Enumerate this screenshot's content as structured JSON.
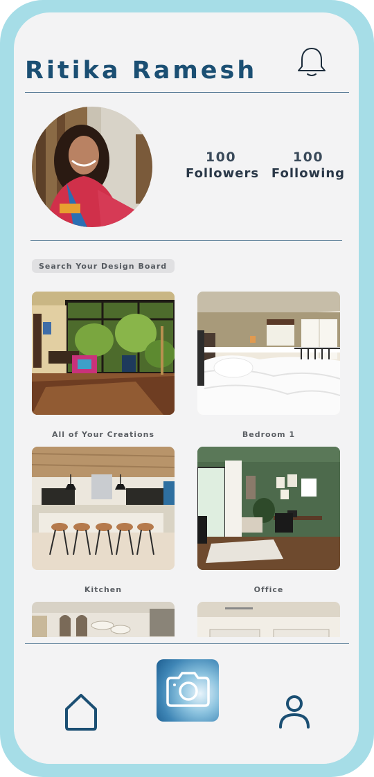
{
  "header": {
    "title": "Ritika Ramesh",
    "notification_icon": "bell-icon"
  },
  "profile": {
    "followers_count": "100",
    "followers_label": "Followers",
    "following_count": "100",
    "following_label": "Following"
  },
  "search": {
    "placeholder": "Search Your Design Board"
  },
  "boards": [
    {
      "label": "All of Your Creations"
    },
    {
      "label": "Bedroom 1"
    },
    {
      "label": "Kitchen"
    },
    {
      "label": "Office"
    },
    {
      "label": ""
    },
    {
      "label": ""
    }
  ],
  "nav": {
    "home_icon": "home-icon",
    "camera_icon": "camera-icon",
    "profile_icon": "user-icon"
  },
  "colors": {
    "frame": "#a6dde7",
    "screen": "#f3f3f4",
    "accent": "#1b4f73"
  }
}
